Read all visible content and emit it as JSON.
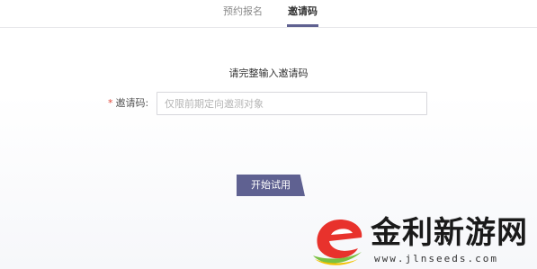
{
  "tabs": [
    {
      "label": "预约报名",
      "active": false
    },
    {
      "label": "邀请码",
      "active": true
    }
  ],
  "form": {
    "prompt": "请完整输入邀请码",
    "required_mark": "*",
    "label": "邀请码:",
    "input_value": "",
    "input_placeholder": "仅限前期定向邀测对象"
  },
  "start_button": {
    "label": "开始试用"
  },
  "watermark": {
    "title": "金利新游网",
    "url": "www.jlnseeds.com"
  },
  "colors": {
    "accent": "#5f6191",
    "required": "#e0473a",
    "logo_red": "#e8322c",
    "logo_green": "#7ac142",
    "logo_yellow": "#f2c200"
  }
}
